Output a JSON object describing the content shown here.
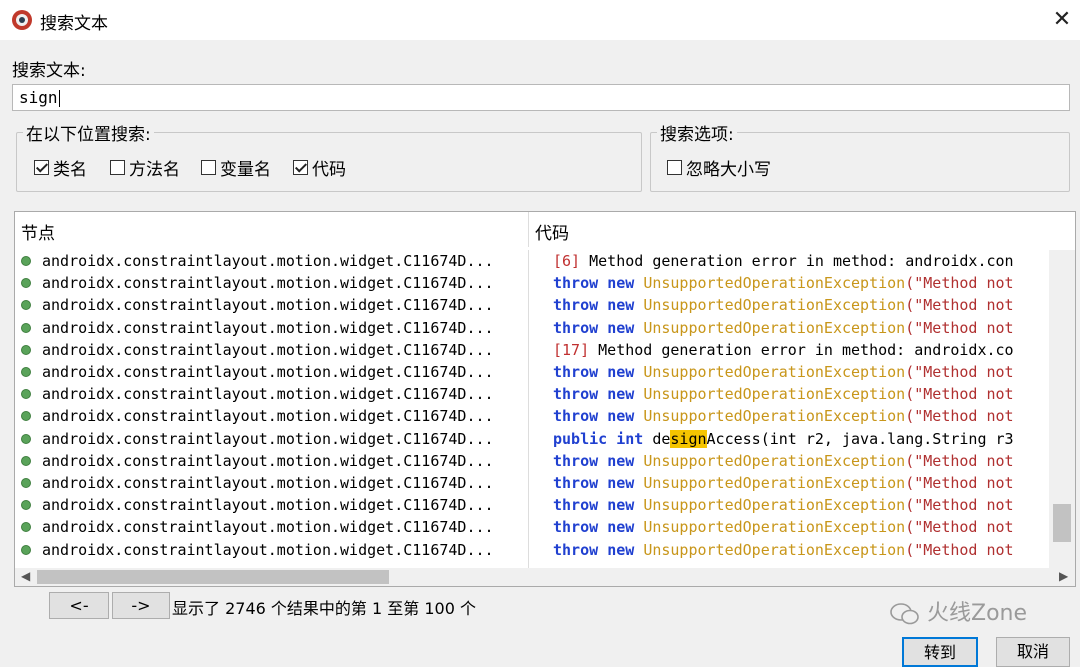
{
  "window": {
    "title": "搜索文本",
    "close_glyph": "✕",
    "icon": "app-logo-icon"
  },
  "search": {
    "label": "搜索文本:",
    "value": "sign"
  },
  "location_group": {
    "legend": "在以下位置搜索:",
    "options": [
      {
        "label": "类名",
        "checked": true
      },
      {
        "label": "方法名",
        "checked": false
      },
      {
        "label": "变量名",
        "checked": false
      },
      {
        "label": "代码",
        "checked": true
      }
    ]
  },
  "options_group": {
    "legend": "搜索选项:",
    "options": [
      {
        "label": "忽略大小写",
        "checked": false
      }
    ]
  },
  "results": {
    "headers": {
      "node": "节点",
      "code": "代码"
    },
    "node_rows": [
      "androidx.constraintlayout.motion.widget.C11674D...",
      "androidx.constraintlayout.motion.widget.C11674D...",
      "androidx.constraintlayout.motion.widget.C11674D...",
      "androidx.constraintlayout.motion.widget.C11674D...",
      "androidx.constraintlayout.motion.widget.C11674D...",
      "androidx.constraintlayout.motion.widget.C11674D...",
      "androidx.constraintlayout.motion.widget.C11674D...",
      "androidx.constraintlayout.motion.widget.C11674D...",
      "androidx.constraintlayout.motion.widget.C11674D...",
      "androidx.constraintlayout.motion.widget.C11674D...",
      "androidx.constraintlayout.motion.widget.C11674D...",
      "androidx.constraintlayout.motion.widget.C11674D...",
      "androidx.constraintlayout.motion.widget.C11674D...",
      "androidx.constraintlayout.motion.widget.C11674D..."
    ],
    "code_rows": [
      {
        "type": "error",
        "tag": "[6]",
        "text": " Method generation error in method: androidx.con"
      },
      {
        "type": "throw",
        "kw1": "throw",
        "kw2": "new",
        "cls": "UnsupportedOperationException",
        "str": "(\"Method not"
      },
      {
        "type": "throw",
        "kw1": "throw",
        "kw2": "new",
        "cls": "UnsupportedOperationException",
        "str": "(\"Method not"
      },
      {
        "type": "throw",
        "kw1": "throw",
        "kw2": "new",
        "cls": "UnsupportedOperationException",
        "str": "(\"Method not"
      },
      {
        "type": "error",
        "tag": "[17]",
        "text": " Method generation error in method: androidx.co"
      },
      {
        "type": "throw",
        "kw1": "throw",
        "kw2": "new",
        "cls": "UnsupportedOperationException",
        "str": "(\"Method not"
      },
      {
        "type": "throw",
        "kw1": "throw",
        "kw2": "new",
        "cls": "UnsupportedOperationException",
        "str": "(\"Method not"
      },
      {
        "type": "throw",
        "kw1": "throw",
        "kw2": "new",
        "cls": "UnsupportedOperationException",
        "str": "(\"Method not"
      },
      {
        "type": "decl",
        "kw1": "public",
        "kw2": "int",
        "pre": "de",
        "match": "sign",
        "post": "Access",
        "args": "(int r2, java.lang.String r3"
      },
      {
        "type": "throw",
        "kw1": "throw",
        "kw2": "new",
        "cls": "UnsupportedOperationException",
        "str": "(\"Method not"
      },
      {
        "type": "throw",
        "kw1": "throw",
        "kw2": "new",
        "cls": "UnsupportedOperationException",
        "str": "(\"Method not"
      },
      {
        "type": "throw",
        "kw1": "throw",
        "kw2": "new",
        "cls": "UnsupportedOperationException",
        "str": "(\"Method not"
      },
      {
        "type": "throw",
        "kw1": "throw",
        "kw2": "new",
        "cls": "UnsupportedOperationException",
        "str": "(\"Method not"
      },
      {
        "type": "throw",
        "kw1": "throw",
        "kw2": "new",
        "cls": "UnsupportedOperationException",
        "str": "(\"Method not"
      }
    ]
  },
  "pager": {
    "prev_label": "<-",
    "next_label": "->",
    "status": "显示了 2746 个结果中的第 1 至第 100 个"
  },
  "actions": {
    "goto_label": "转到",
    "cancel_label": "取消"
  },
  "watermark": {
    "text": "火线Zone",
    "icon": "wechat-icon"
  },
  "colors": {
    "keyword": "#2040d0",
    "class": "#c8961a",
    "string": "#b03030",
    "highlight": "#f5c400",
    "node_dot": "#5aa35a"
  }
}
